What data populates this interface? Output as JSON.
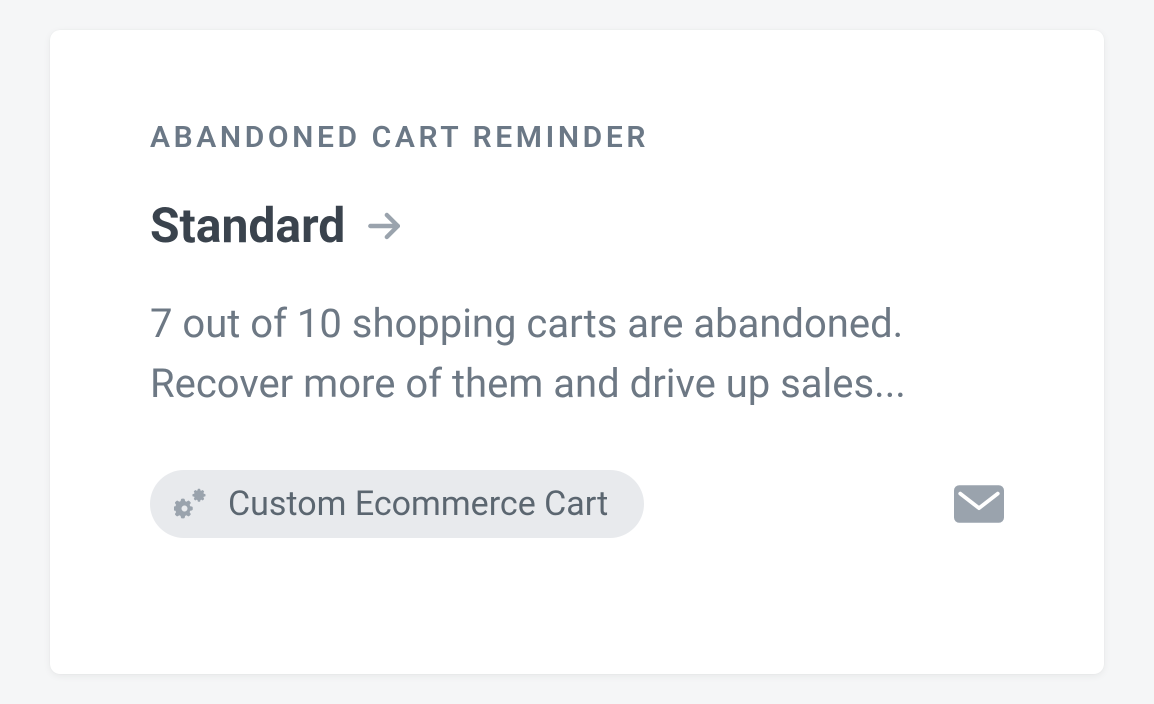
{
  "card": {
    "eyebrow": "ABANDONED CART REMINDER",
    "title": "Standard",
    "description": "7 out of 10 shopping carts are abandoned. Recover more of them and drive up sales...",
    "tag": {
      "label": "Custom Ecommerce Cart"
    }
  }
}
